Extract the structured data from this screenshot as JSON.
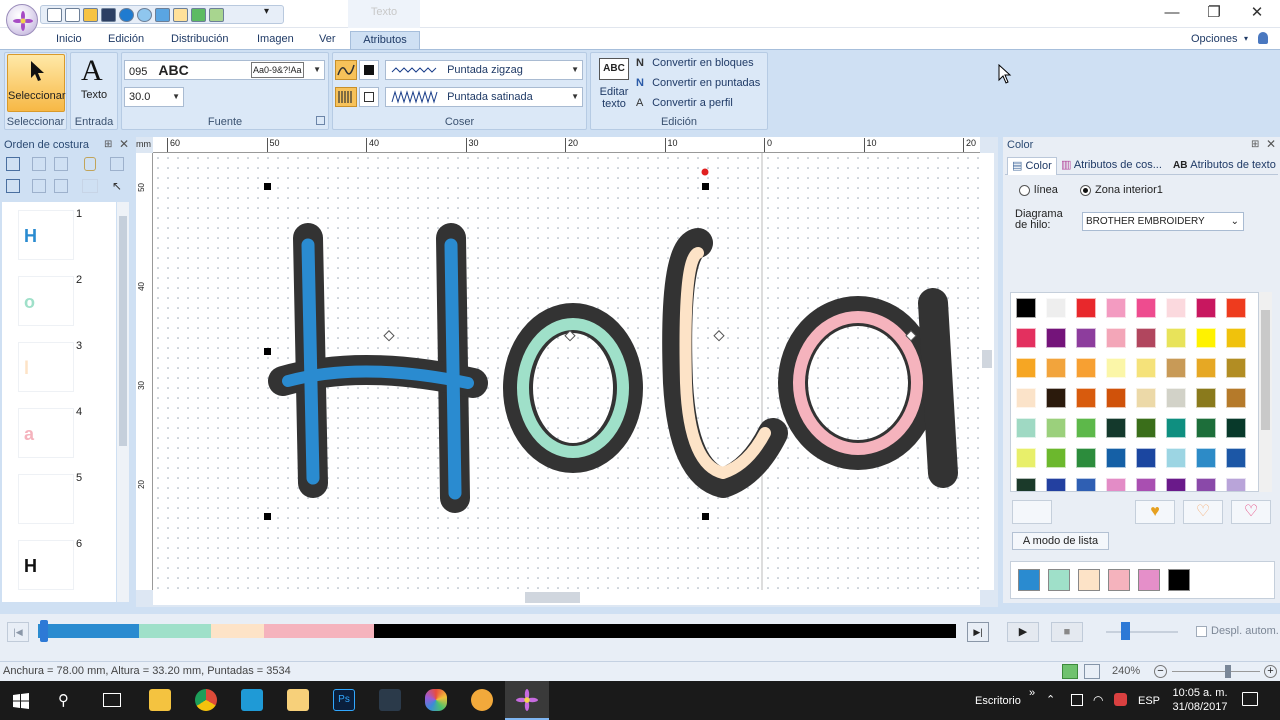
{
  "titlebar": {
    "context_tab": "Texto",
    "qat_more": "▾",
    "minimize": "—",
    "restore": "❐",
    "close": "✕"
  },
  "tabs": [
    "Inicio",
    "Edición",
    "Distribución",
    "Imagen",
    "Ver",
    "Atributos"
  ],
  "options": {
    "label": "Opciones",
    "arrow": "▾"
  },
  "ribbon": {
    "select": {
      "label": "Seleccionar",
      "group": "Seleccionar"
    },
    "text": {
      "label": "Texto",
      "group": "Entrada"
    },
    "font": {
      "number": "095",
      "sample": "ABC",
      "preview": "Aa0-9&?!Aa",
      "size": "30.0",
      "group": "Fuente"
    },
    "sew": {
      "zigzag": "Puntada zigzag",
      "satin": "Puntada satinada",
      "group": "Coser"
    },
    "edit": {
      "edit_text": "Editar texto",
      "abc": "ABC",
      "blocks": "Convertir en bloques",
      "stitches": "Convertir en puntadas",
      "outline": "Convertir a perfil",
      "group": "Edición"
    }
  },
  "sew_order": {
    "title": "Orden de costura",
    "items": [
      {
        "num": "1",
        "glyph": "H",
        "color": "#2a8bd0"
      },
      {
        "num": "2",
        "glyph": "o",
        "color": "#9fe0c9"
      },
      {
        "num": "3",
        "glyph": "l",
        "color": "#fde3c7"
      },
      {
        "num": "4",
        "glyph": "a",
        "color": "#f5b3bd"
      },
      {
        "num": "5",
        "glyph": "",
        "color": "#ffffff"
      },
      {
        "num": "6",
        "glyph": "H",
        "color": "#111111"
      }
    ]
  },
  "ruler": {
    "unit": "mm",
    "h_labels": [
      "60",
      "50",
      "40",
      "30",
      "20",
      "10",
      "0",
      "10",
      "20"
    ],
    "v_labels": [
      "50",
      "40",
      "30",
      "20"
    ]
  },
  "design_text": "Hola",
  "color_panel": {
    "title": "Color",
    "tabs": [
      "Color",
      "Atributos de cos...",
      "Atributos de texto"
    ],
    "radio_line": "línea",
    "radio_zone": "Zona interior1",
    "thread_chart_label": "Diagrama de hilo:",
    "thread_chart_value": "BROTHER EMBROIDERY",
    "list_mode_button": "A modo de lista",
    "palette": [
      "#000000",
      "#eeeeee",
      "#e8282c",
      "#f39bc1",
      "#ee4c8f",
      "#fbd9de",
      "#c8175f",
      "#ee3b1e",
      "#e3305f",
      "#74147a",
      "#8d3d9d",
      "#f3a6b8",
      "#b1465e",
      "#e8e35a",
      "#fff200",
      "#f0c20c",
      "#f6a623",
      "#f2a43c",
      "#f7a032",
      "#fbf6a8",
      "#f5e27a",
      "#c89a57",
      "#e6a824",
      "#b28d23",
      "#fbe3c9",
      "#2b1a0c",
      "#d85b0d",
      "#d0520a",
      "#ecd9a8",
      "#d2d2c8",
      "#8a7a1c",
      "#b57a2a",
      "#9fd9c3",
      "#9bd07c",
      "#5db84a",
      "#14392c",
      "#3a6e1a",
      "#0f8f80",
      "#1d6e3a",
      "#08392a",
      "#e8ef6a",
      "#6cb82d",
      "#2c8c3c",
      "#1560a6",
      "#1b46a0",
      "#9cd5e3",
      "#2d8bc7",
      "#1c57a6",
      "#1b3a2a",
      "#2340a0",
      "#2f5fb3",
      "#e38cc6",
      "#a94fb1",
      "#6a1a8a",
      "#8a49a9",
      "#b9a4d9"
    ],
    "used_colors": [
      "#2a8bd0",
      "#9fe0c9",
      "#fde3c7",
      "#f5b3bd",
      "#e58fc9",
      "#000000"
    ]
  },
  "player": {
    "segments": [
      {
        "color": "#2a8bd0",
        "fraction": 0.11
      },
      {
        "color": "#9fe0c9",
        "fraction": 0.078
      },
      {
        "color": "#fde3c7",
        "fraction": 0.058
      },
      {
        "color": "#f5b3bd",
        "fraction": 0.12
      },
      {
        "color": "#000000",
        "fraction": 0.634
      }
    ],
    "scroll_label": "Despl. autom."
  },
  "status": {
    "text": "Anchura = 78.00 mm, Altura = 33.20 mm, Puntadas = 3534",
    "zoom": "240%"
  },
  "taskbar": {
    "location": "Escritorio",
    "chevron": "»",
    "lang": "ESP",
    "time": "10:05 a. m.",
    "date": "31/08/2017"
  }
}
